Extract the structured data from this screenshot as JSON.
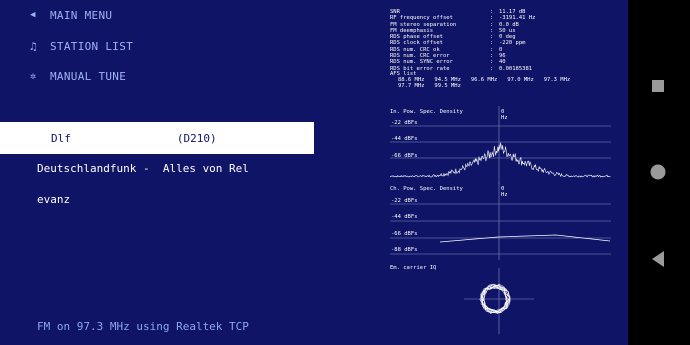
{
  "menu": {
    "main_menu": "MAIN MENU",
    "station_list": "STATION LIST",
    "manual_tune": "MANUAL TUNE"
  },
  "station": {
    "selected_label": "Dlf                (D210)",
    "text_line1": "Deutschlandfunk -  Alles von Rel",
    "text_line2": "evanz"
  },
  "status": "FM on 97.3 MHz using Realtek TCP",
  "stats": [
    {
      "k": "SNR",
      "v": "11.17 dB"
    },
    {
      "k": "RF frequency offset",
      "v": "-3191.41 Hz"
    },
    {
      "k": "FM stereo separation",
      "v": "0.0 dB"
    },
    {
      "k": "FM deemphasis",
      "v": "50 us"
    },
    {
      "k": "RDS phase offset",
      "v": "0 deg"
    },
    {
      "k": "RDS clock offset",
      "v": "-220 ppm"
    },
    {
      "k": "RDS num. CRC ok",
      "v": "0"
    },
    {
      "k": "RDS num. CRC error",
      "v": "96"
    },
    {
      "k": "RDS num. SYNC error",
      "v": "40"
    },
    {
      "k": "RDS bit error rate",
      "v": "0.00185381"
    }
  ],
  "afs": {
    "title": "AFS list",
    "row1": "88.6 MHz   94.5 MHz   96.6 MHz   97.0 MHz   97.3 MHz",
    "row2": "97.7 MHz   99.5 MHz"
  },
  "input_psd": {
    "title": "In. Pow. Spec. Density",
    "hz": "0 Hz",
    "labels": [
      "-22 dBFs",
      "-44 dBFs",
      "-66 dBFs"
    ]
  },
  "channel_psd": {
    "title": "Ch. Pow. Spec. Density",
    "hz": "0 Hz",
    "labels": [
      "-22 dBFs",
      "-44 dBFs",
      "-66 dBFs",
      "-88 dBFs"
    ]
  },
  "carrier": {
    "title": "Em. carrier IQ"
  },
  "colors": {
    "background": "#0f1466",
    "menu_text": "#9fb4f2",
    "status_text": "#8da6ef",
    "selected_bg": "#ffffff"
  },
  "icons": {
    "main_menu": "triangle-left-icon",
    "station_list": "music-note-icon",
    "manual_tune": "gear-icon",
    "nav_back": "back-triangle-icon",
    "nav_home": "home-circle-icon",
    "nav_recents": "recents-square-icon"
  }
}
